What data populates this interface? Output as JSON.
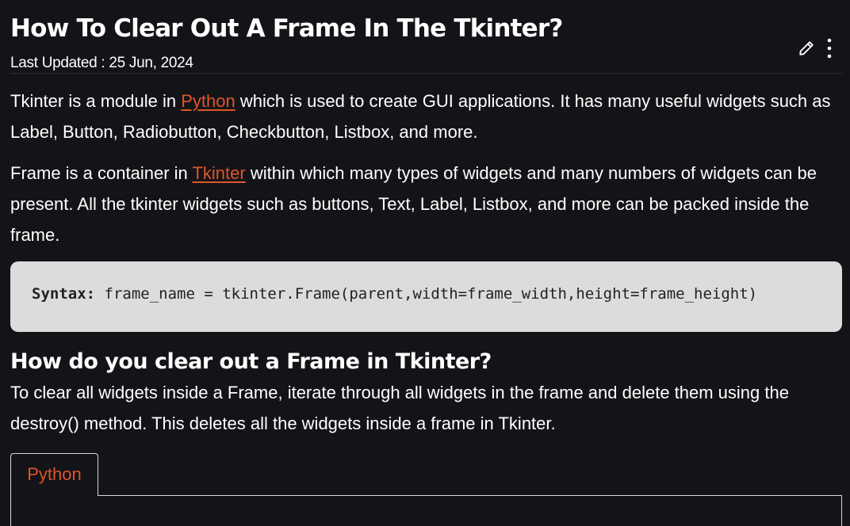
{
  "article": {
    "title": "How To Clear Out A Frame In The Tkinter?",
    "last_updated": "Last Updated : 25 Jun, 2024"
  },
  "actions": {
    "edit_icon": "pencil-icon",
    "more_icon": "more-vertical-icon"
  },
  "paragraph1": {
    "before": "Tkinter is a module in ",
    "link": "Python",
    "after": " which is used to create GUI applications. It has many useful widgets such as Label, Button, Radiobutton, Checkbutton, Listbox, and more."
  },
  "paragraph2": {
    "before": "Frame is a container in ",
    "link": "Tkinter",
    "after": " within which many types of widgets and many numbers of widgets can be present. All the tkinter widgets such as buttons, Text, Label, Listbox, and more can be packed inside the frame."
  },
  "syntax": {
    "label": "Syntax:",
    "code": " frame_name = tkinter.Frame(parent,width=frame_width,height=frame_height)"
  },
  "section": {
    "heading": "How do you clear out a Frame in Tkinter?",
    "text": "To clear all widgets inside a Frame, iterate through all widgets in the frame and delete them using the destroy() method. This deletes all the widgets inside a frame in Tkinter."
  },
  "code_tabs": {
    "active": "Python"
  },
  "colors": {
    "background": "#131417",
    "link": "#e0542a",
    "syntax_bg": "#dcdcdc"
  }
}
